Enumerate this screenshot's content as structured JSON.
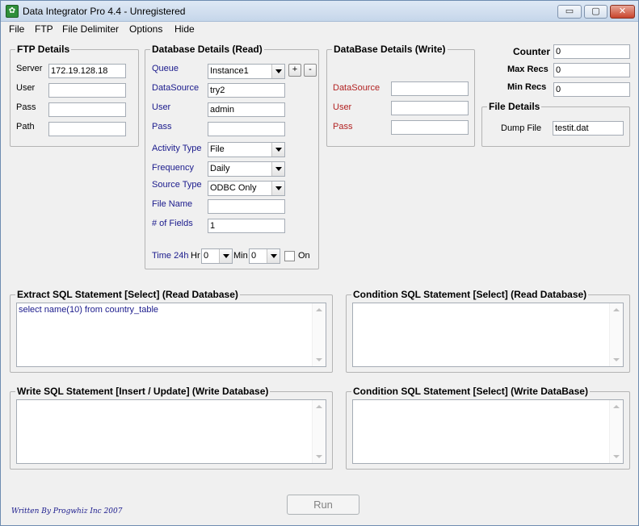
{
  "window": {
    "title": "Data Integrator Pro 4.4 - Unregistered",
    "controls": {
      "minimize": "▭",
      "maximize": "▢",
      "close": "✕"
    }
  },
  "menu": [
    "File",
    "FTP",
    "File Delimiter",
    "Options",
    "Hide"
  ],
  "ftp": {
    "title": "FTP Details",
    "server_label": "Server",
    "server_value": "172.19.128.18",
    "user_label": "User",
    "user_value": "",
    "pass_label": "Pass",
    "pass_value": "",
    "path_label": "Path",
    "path_value": ""
  },
  "read_db": {
    "title": "Database Details (Read)",
    "queue_label": "Queue",
    "queue_value": "Instance1",
    "plus": "+",
    "minus": "-",
    "datasource_label": "DataSource",
    "datasource_value": "try2",
    "user_label": "User",
    "user_value": "admin",
    "pass_label": "Pass",
    "pass_value": "",
    "activity_label": "Activity Type",
    "activity_value": "File",
    "frequency_label": "Frequency",
    "frequency_value": "Daily",
    "source_label": "Source Type",
    "source_value": "ODBC Only",
    "filename_label": "File Name",
    "filename_value": "",
    "fields_label": "# of Fields",
    "fields_value": "1",
    "time_label": "Time 24h",
    "hr_label": "Hr",
    "hr_value": "0",
    "min_label": "Min",
    "min_value": "0",
    "on_label": "On"
  },
  "write_db": {
    "title": "DataBase Details (Write)",
    "datasource_label": "DataSource",
    "datasource_value": "",
    "user_label": "User",
    "user_value": "",
    "pass_label": "Pass",
    "pass_value": ""
  },
  "counters": {
    "counter_label": "Counter",
    "counter_value": "0",
    "maxrecs_label": "Max Recs",
    "maxrecs_value": "0",
    "minrecs_label": "Min Recs",
    "minrecs_value": "0"
  },
  "file_details": {
    "title": "File Details",
    "dump_label": "Dump File",
    "dump_value": "testit.dat"
  },
  "sql": {
    "extract_title": "Extract SQL Statement [Select] (Read Database)",
    "extract_value": "select name(10) from country_table",
    "cond_read_title": "Condition SQL Statement [Select] (Read Database)",
    "cond_read_value": "",
    "write_title": "Write SQL Statement [Insert / Update] (Write Database)",
    "write_value": "",
    "cond_write_title": "Condition SQL Statement [Select] (Write DataBase)",
    "cond_write_value": ""
  },
  "run_label": "Run",
  "footer": "Written By Progwhiz Inc 2007"
}
